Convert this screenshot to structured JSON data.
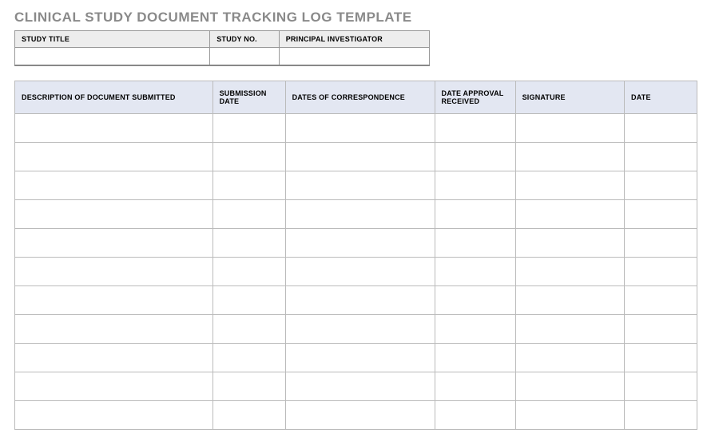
{
  "title": "CLINICAL STUDY DOCUMENT TRACKING LOG TEMPLATE",
  "meta": {
    "headers": {
      "study_title": "STUDY TITLE",
      "study_no": "STUDY NO.",
      "principal_investigator": "PRINCIPAL INVESTIGATOR"
    },
    "values": {
      "study_title": "",
      "study_no": "",
      "principal_investigator": ""
    }
  },
  "columns": {
    "description": "DESCRIPTION OF DOCUMENT SUBMITTED",
    "submission_date": "SUBMISSION DATE",
    "correspondence": "DATES OF CORRESPONDENCE",
    "approval_received": "DATE APPROVAL RECEIVED",
    "signature": "SIGNATURE",
    "date": "DATE"
  },
  "rows": [
    {
      "description": "",
      "submission_date": "",
      "correspondence": "",
      "approval_received": "",
      "signature": "",
      "date": ""
    },
    {
      "description": "",
      "submission_date": "",
      "correspondence": "",
      "approval_received": "",
      "signature": "",
      "date": ""
    },
    {
      "description": "",
      "submission_date": "",
      "correspondence": "",
      "approval_received": "",
      "signature": "",
      "date": ""
    },
    {
      "description": "",
      "submission_date": "",
      "correspondence": "",
      "approval_received": "",
      "signature": "",
      "date": ""
    },
    {
      "description": "",
      "submission_date": "",
      "correspondence": "",
      "approval_received": "",
      "signature": "",
      "date": ""
    },
    {
      "description": "",
      "submission_date": "",
      "correspondence": "",
      "approval_received": "",
      "signature": "",
      "date": ""
    },
    {
      "description": "",
      "submission_date": "",
      "correspondence": "",
      "approval_received": "",
      "signature": "",
      "date": ""
    },
    {
      "description": "",
      "submission_date": "",
      "correspondence": "",
      "approval_received": "",
      "signature": "",
      "date": ""
    },
    {
      "description": "",
      "submission_date": "",
      "correspondence": "",
      "approval_received": "",
      "signature": "",
      "date": ""
    },
    {
      "description": "",
      "submission_date": "",
      "correspondence": "",
      "approval_received": "",
      "signature": "",
      "date": ""
    },
    {
      "description": "",
      "submission_date": "",
      "correspondence": "",
      "approval_received": "",
      "signature": "",
      "date": ""
    }
  ]
}
